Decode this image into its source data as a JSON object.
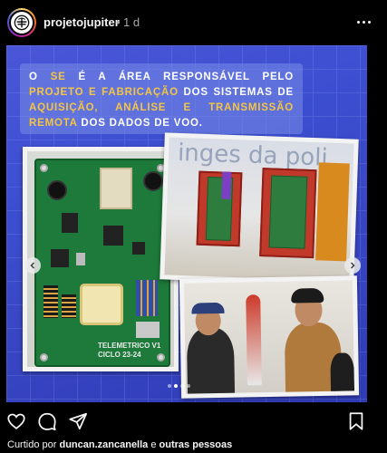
{
  "post": {
    "username": "projetojupiter",
    "separator": "•",
    "time": "1 d",
    "more_icon": "more-horizontal-icon"
  },
  "slide": {
    "caption_parts": [
      {
        "text": "O ",
        "highlight": false
      },
      {
        "text": "SE",
        "highlight": true
      },
      {
        "text": " É A ÁREA RESPONSÁVEL PELO ",
        "highlight": false
      },
      {
        "text": "PROJETO E FABRICAÇÃO",
        "highlight": true
      },
      {
        "text": " DOS SISTEMAS DE ",
        "highlight": false
      },
      {
        "text": "AQUISIÇÃO, ANÁLISE E TRANSMISSÃO REMOTA",
        "highlight": true
      },
      {
        "text": " DOS DADOS DE VOO.",
        "highlight": false
      }
    ],
    "pcb_label_line1": "TELEMETRICO V1",
    "pcb_label_line2": "CICLO 23-24",
    "sign_text": "inges da poli",
    "carousel": {
      "total": 4,
      "active": 1
    }
  },
  "actions": {
    "like_icon": "heart-icon",
    "comment_icon": "comment-icon",
    "share_icon": "share-icon",
    "save_icon": "bookmark-icon"
  },
  "likes": {
    "prefix": "Curtido por",
    "user": "duncan.zancanella",
    "connector": "e",
    "others": "outras pessoas"
  },
  "colors": {
    "highlight": "#f4c542",
    "background": "#000000",
    "slide_blue": "#3c4ed0"
  }
}
